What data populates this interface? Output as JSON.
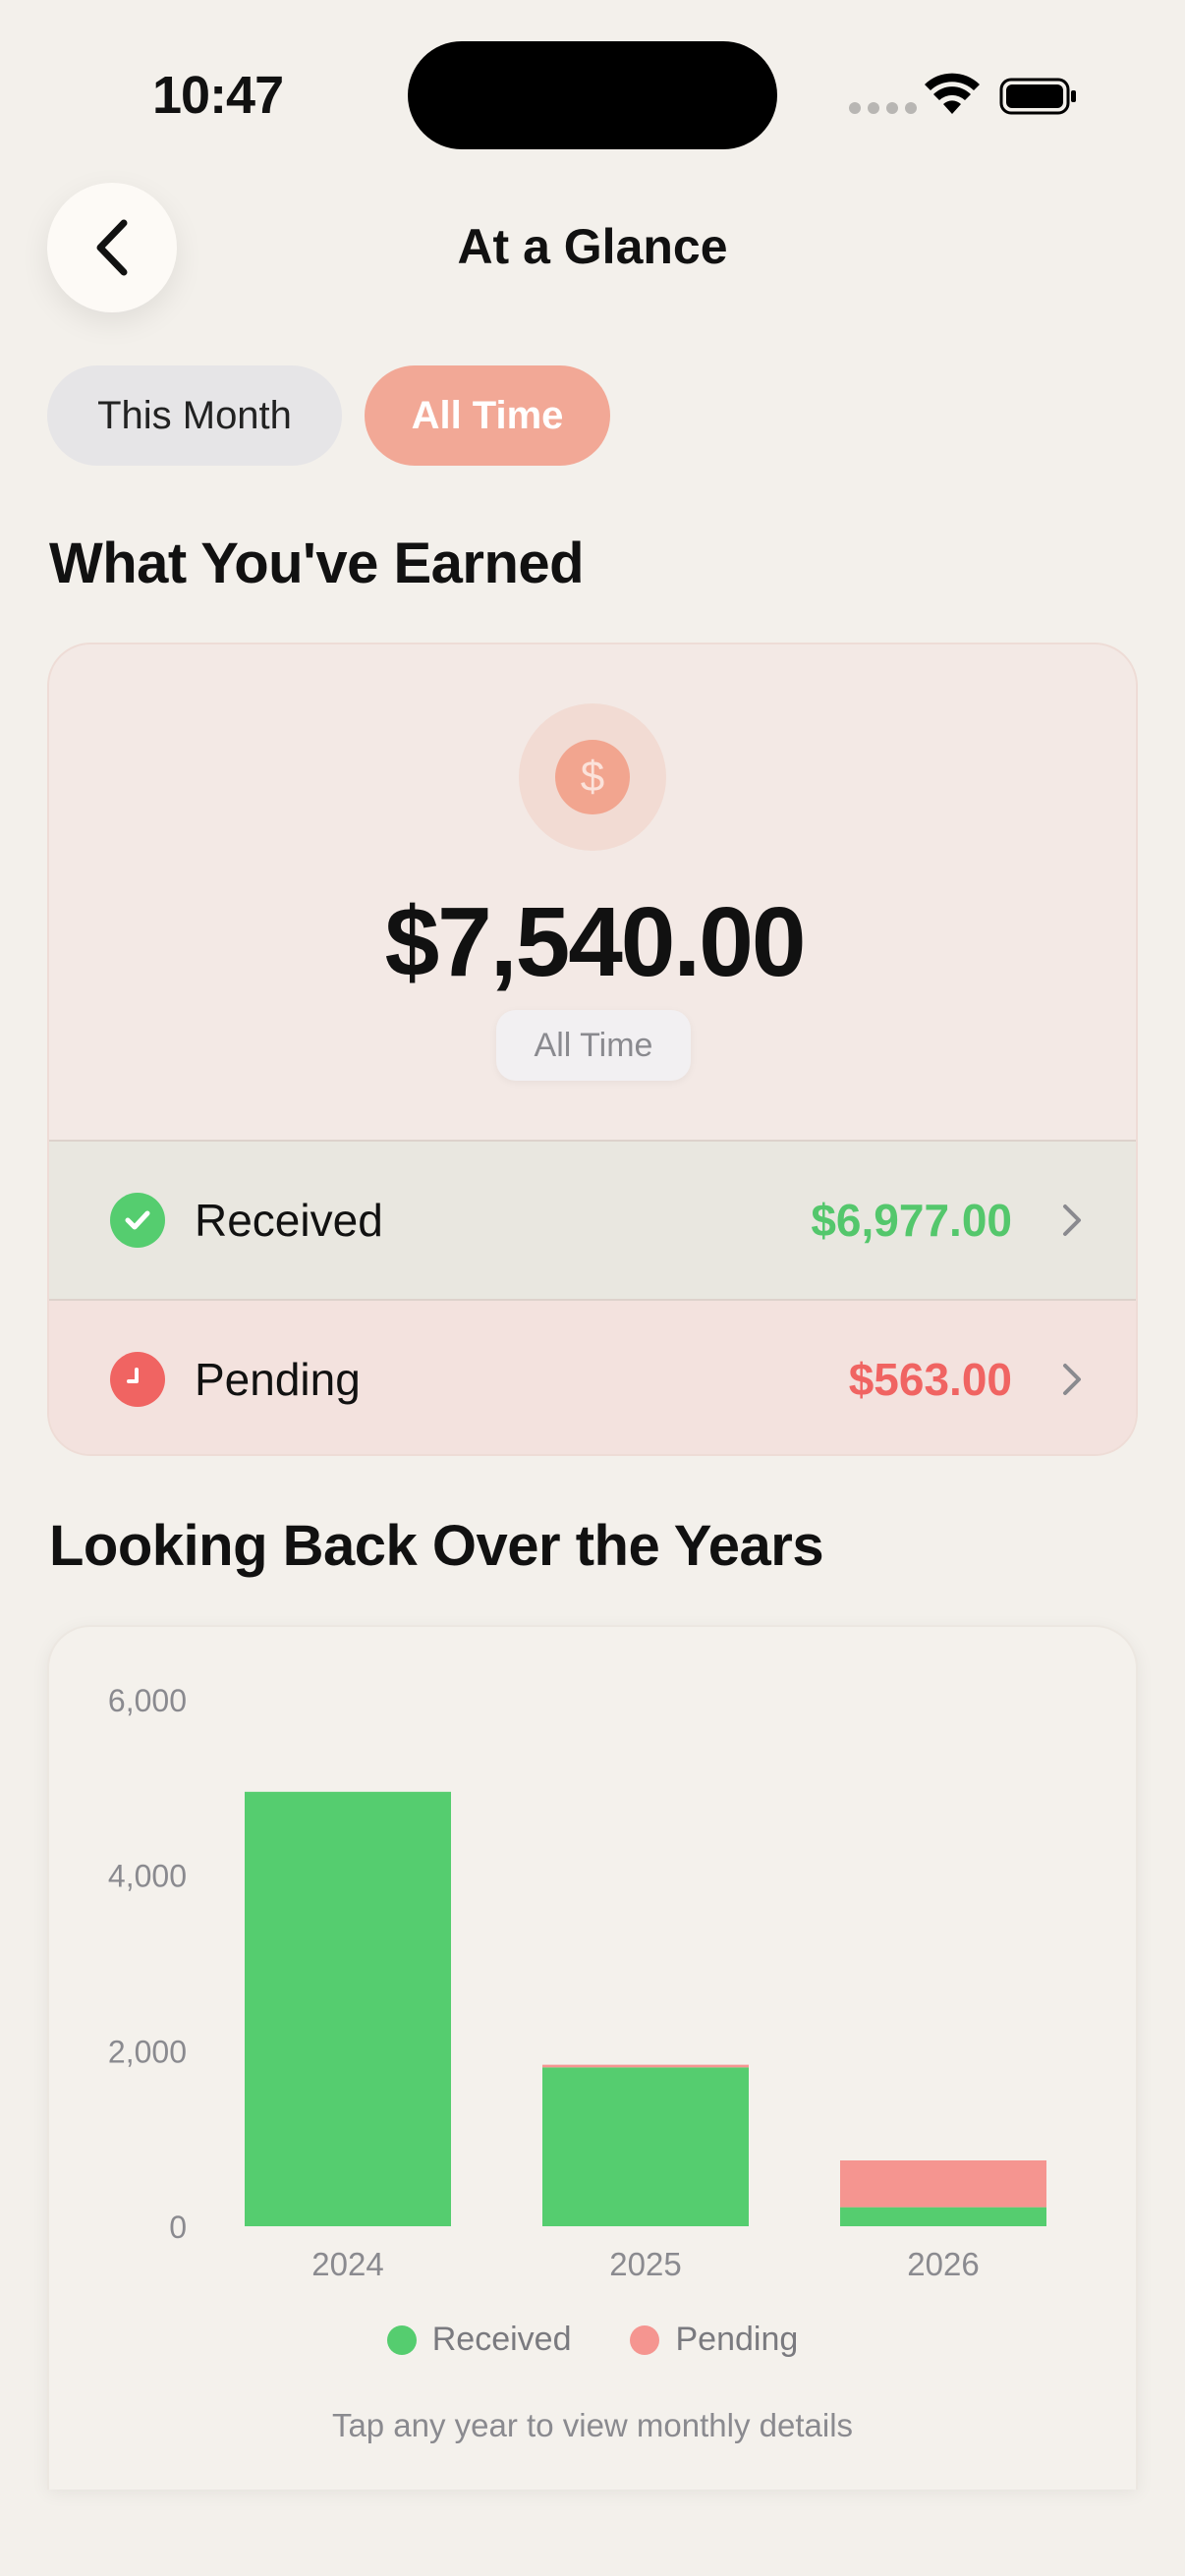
{
  "status_bar": {
    "time": "10:47"
  },
  "header": {
    "title": "At a Glance"
  },
  "segments": {
    "this_month": "This Month",
    "all_time": "All Time",
    "selected": "all_time"
  },
  "earned": {
    "section_title": "What You've Earned",
    "total": "$7,540.00",
    "period": "All Time",
    "received_label": "Received",
    "received_amount": "$6,977.00",
    "pending_label": "Pending",
    "pending_amount": "$563.00"
  },
  "history": {
    "section_title": "Looking Back Over the Years",
    "hint": "Tap any year to view monthly details"
  },
  "colors": {
    "accent": "#f2a896",
    "received": "#55cd6f",
    "pending": "#f59590",
    "received_text": "#54c76c",
    "pending_text": "#f06462"
  },
  "chart_data": {
    "type": "bar",
    "stacked": true,
    "categories": [
      "2024",
      "2025",
      "2026"
    ],
    "series": [
      {
        "name": "Received",
        "values": [
          4950,
          1810,
          217
        ]
      },
      {
        "name": "Pending",
        "values": [
          0,
          30,
          533
        ]
      }
    ],
    "y_ticks": [
      "0",
      "2,000",
      "4,000",
      "6,000"
    ],
    "ylim": [
      0,
      6000
    ],
    "legend": [
      "Received",
      "Pending"
    ],
    "legend_position": "bottom",
    "grid": false
  }
}
